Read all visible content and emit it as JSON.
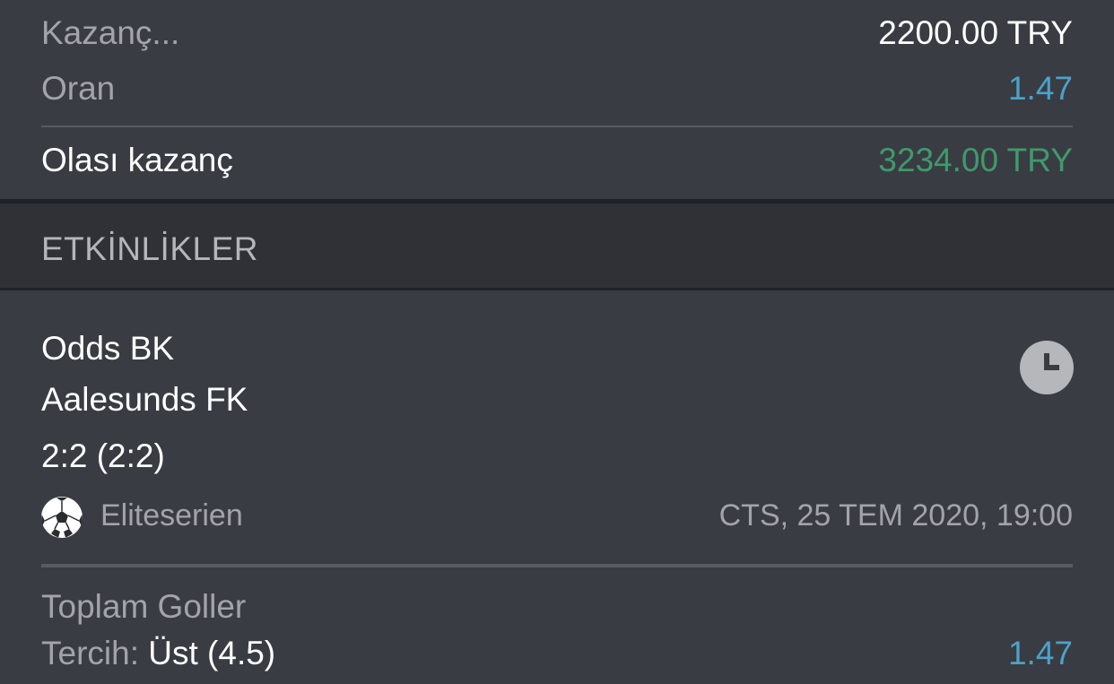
{
  "summary": {
    "stake_label": "Kazanç...",
    "stake_value": "2200.00 TRY",
    "odds_label": "Oran",
    "odds_value": "1.47",
    "potential_label": "Olası kazanç",
    "potential_value": "3234.00 TRY"
  },
  "events_section": {
    "title": "ETKİNLİKLER"
  },
  "event": {
    "home_team": "Odds BK",
    "away_team": "Aalesunds FK",
    "score": "2:2 (2:2)",
    "league": "Eliteserien",
    "datetime": "CTS, 25 TEM 2020, 19:00",
    "status_icon": "clock-icon",
    "sport_icon": "soccer-ball-icon",
    "market": "Toplam Goller",
    "pick_label": "Tercih:",
    "pick_value": "Üst (4.5)",
    "pick_odds": "1.47"
  },
  "colors": {
    "background": "#3a3c43",
    "section_band": "#2f3137",
    "muted_text": "#a2a4aa",
    "odds_blue": "#4aa3c9",
    "win_green": "#3f9a6c"
  }
}
